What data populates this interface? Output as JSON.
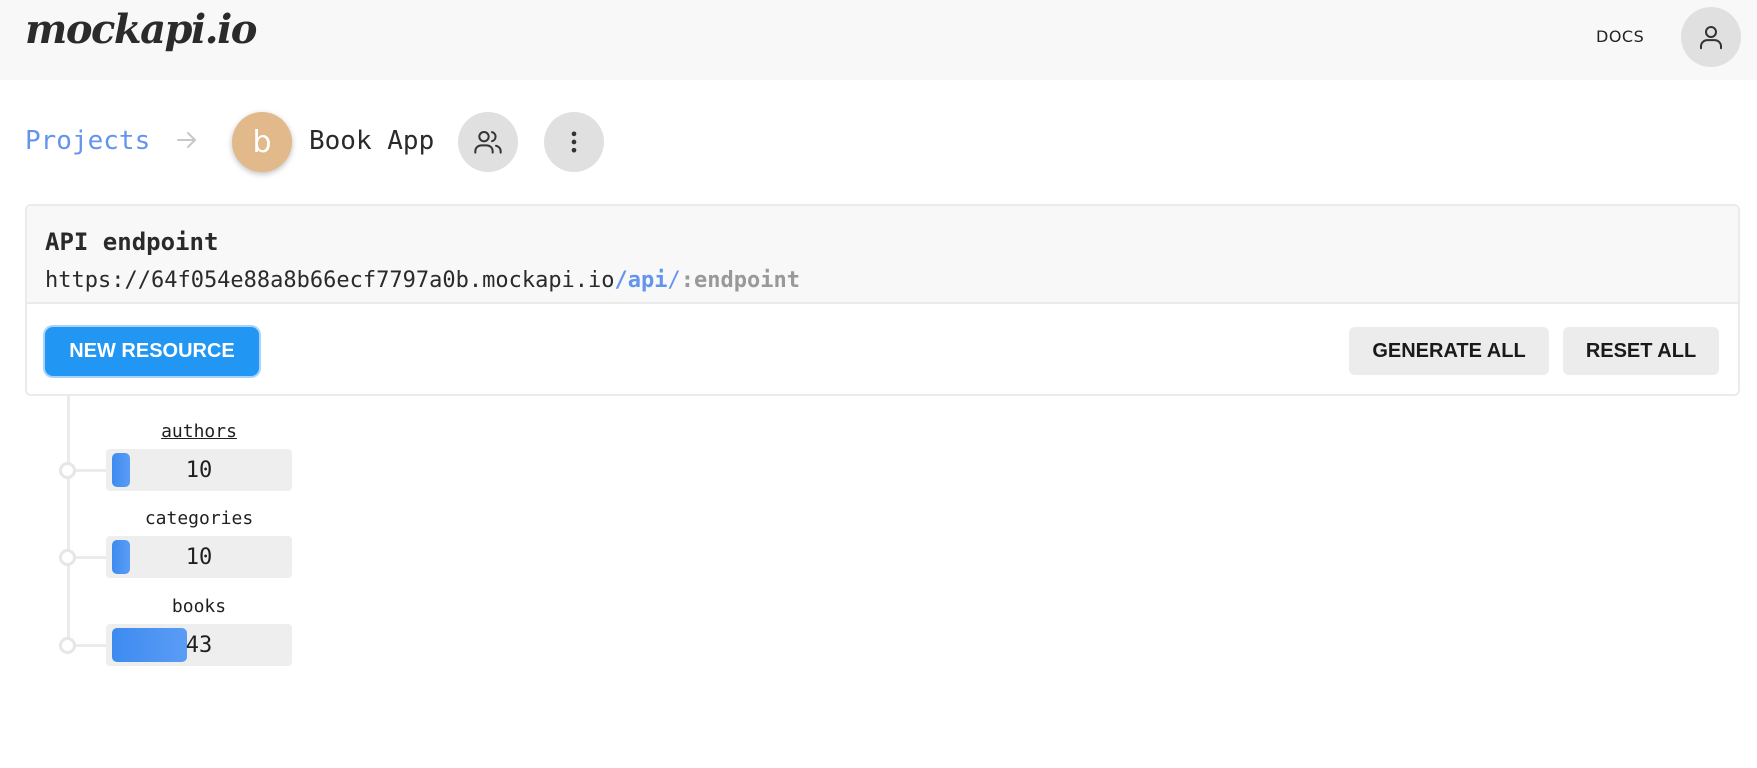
{
  "app": {
    "logo_text": "mockapi.io"
  },
  "header": {
    "docs_label": "DOCS",
    "user_icon": "user-icon"
  },
  "breadcrumb": {
    "projects_label": "Projects",
    "separator_icon": "arrow-right-icon",
    "project_initial": "b",
    "project_name": "Book App",
    "members_icon": "users-icon",
    "menu_icon": "more-vertical-icon"
  },
  "endpoint_card": {
    "title": "API endpoint",
    "url_base": "https://64f054e88a8b66ecf7797a0b.mockapi.io",
    "url_api": "/api",
    "url_slash": "/",
    "url_param": ":endpoint",
    "new_resource_label": "NEW RESOURCE",
    "generate_all_label": "GENERATE ALL",
    "reset_all_label": "RESET ALL"
  },
  "resources": [
    {
      "name": "authors",
      "count": "10",
      "fill_fraction": 0.1
    },
    {
      "name": "categories",
      "count": "10",
      "fill_fraction": 0.1
    },
    {
      "name": "books",
      "count": "43",
      "fill_fraction": 0.43
    }
  ],
  "colors": {
    "accent": "#2196f3",
    "link": "#6495ed",
    "avatar": "#e2b98a",
    "bar_fill": "#3d8bf0"
  }
}
